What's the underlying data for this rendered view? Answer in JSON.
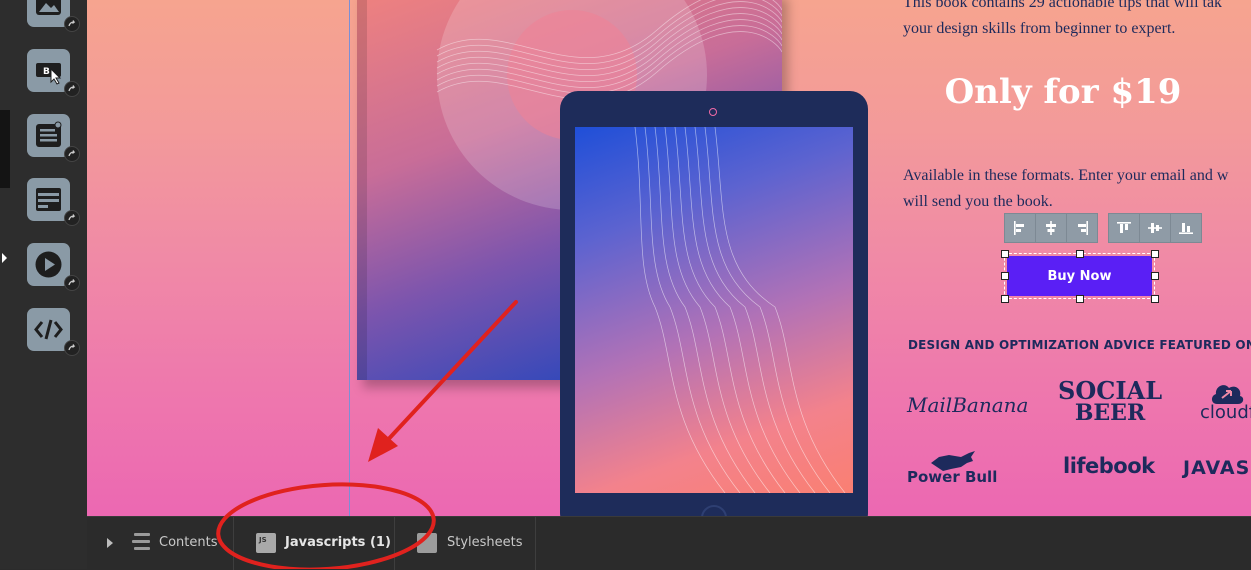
{
  "editor": {
    "sidebar_tools": [
      {
        "name": "image-widget"
      },
      {
        "name": "button-widget"
      },
      {
        "name": "text-widget"
      },
      {
        "name": "form-widget"
      },
      {
        "name": "video-widget"
      },
      {
        "name": "code-widget"
      }
    ],
    "bottom_tabs": [
      {
        "label": "Contents"
      },
      {
        "label": "Javascripts (1)"
      },
      {
        "label": "Stylesheets"
      }
    ],
    "js_icon_text": "JS"
  },
  "page": {
    "intro_line1": "This book contains 29 actionable tips that will tak",
    "intro_line2": "your design skills from beginner to expert.",
    "price": "Only for $19",
    "formats_line1": "Available in these formats. Enter your email and w",
    "formats_line2": "will send you the book.",
    "buy_button": "Buy Now",
    "featured_heading": "DESIGN AND OPTIMIZATION ADVICE FEATURED ON",
    "logos": {
      "mailbanana": "MailBanana",
      "social": "SOCIAL",
      "beer": "BEER",
      "cloudflare": "cloudf",
      "powerbull": "Power Bull",
      "lifebook": "lifebook",
      "javascript": "JAVAS"
    }
  },
  "colors": {
    "accent_button": "#5a1ff5",
    "annotation": "#e0221e",
    "text_dark": "#1d2a5c"
  }
}
